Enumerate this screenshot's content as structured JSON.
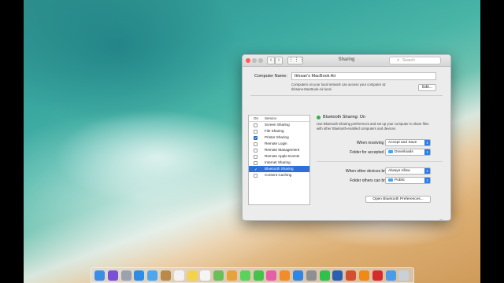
{
  "window": {
    "title": "Sharing",
    "search_placeholder": "Search",
    "grid_glyph": "⋮⋮⋮"
  },
  "computer": {
    "label": "Computer Name:",
    "name": "Ikhsan's MacBook Air",
    "desc_line1": "Computers on your local network can access your computer at:",
    "desc_line2": "Ikhsans-MacBook-Air.local",
    "edit_label": "Edit..."
  },
  "services": {
    "col_on": "On",
    "col_service": "Service",
    "items": [
      {
        "label": "Screen Sharing",
        "checked": false,
        "selected": false
      },
      {
        "label": "File Sharing",
        "checked": false,
        "selected": false
      },
      {
        "label": "Printer Sharing",
        "checked": true,
        "selected": false
      },
      {
        "label": "Remote Login",
        "checked": false,
        "selected": false
      },
      {
        "label": "Remote Management",
        "checked": false,
        "selected": false
      },
      {
        "label": "Remote Apple Events",
        "checked": false,
        "selected": false
      },
      {
        "label": "Internet Sharing",
        "checked": false,
        "selected": false
      },
      {
        "label": "Bluetooth Sharing",
        "checked": true,
        "selected": true
      },
      {
        "label": "Content Caching",
        "checked": false,
        "selected": false
      }
    ]
  },
  "status": {
    "text": "Bluetooth Sharing: On",
    "color": "#35b349",
    "desc_line1": "Use Bluetooth Sharing preferences and set up your computer to share files",
    "desc_line2": "with other Bluetooth-enabled computers and devices."
  },
  "options": {
    "receiving_label": "When receiving items:",
    "receiving_value": "Accept and Save",
    "folder_accepted_label": "Folder for accepted items:",
    "folder_accepted_value": "Downloads",
    "browse_label": "When other devices browse:",
    "browse_value": "Always Allow",
    "folder_browse_label": "Folder others can browse:",
    "folder_browse_value": "Public"
  },
  "open_button": "Open Bluetooth Preferences...",
  "help_glyph": "?",
  "dock": {
    "icons": [
      {
        "name": "finder-icon",
        "color": "#3b8ee8"
      },
      {
        "name": "siri-icon",
        "color": "#7a4fd6"
      },
      {
        "name": "launchpad-icon",
        "color": "#9aa3ad"
      },
      {
        "name": "safari-icon",
        "color": "#2d8ce6"
      },
      {
        "name": "mail-icon",
        "color": "#4da6ee"
      },
      {
        "name": "contacts-icon",
        "color": "#b98a4a"
      },
      {
        "name": "calendar-icon",
        "color": "#f2f2f2"
      },
      {
        "name": "notes-icon",
        "color": "#f4d24a"
      },
      {
        "name": "reminders-icon",
        "color": "#f5f5f5"
      },
      {
        "name": "maps-icon",
        "color": "#6bbf59"
      },
      {
        "name": "photos-icon",
        "color": "#e8a23a"
      },
      {
        "name": "messages-icon",
        "color": "#5ad35a"
      },
      {
        "name": "facetime-icon",
        "color": "#45c24c"
      },
      {
        "name": "itunes-icon",
        "color": "#e45ea8"
      },
      {
        "name": "ibooks-icon",
        "color": "#f08c2a"
      },
      {
        "name": "appstore-icon",
        "color": "#2f86e4"
      },
      {
        "name": "preferences-icon",
        "color": "#8e8e93"
      },
      {
        "name": "whatsapp-icon",
        "color": "#31c04e"
      },
      {
        "name": "word-icon",
        "color": "#2b5fb4"
      },
      {
        "name": "powerpoint-icon",
        "color": "#d2502f"
      },
      {
        "name": "vlc-icon",
        "color": "#ef8a16"
      },
      {
        "name": "record-icon",
        "color": "#d62b2b"
      },
      {
        "name": "downloads-icon",
        "color": "#4a9be8"
      },
      {
        "name": "trash-icon",
        "color": "#c9d1d8"
      }
    ]
  }
}
